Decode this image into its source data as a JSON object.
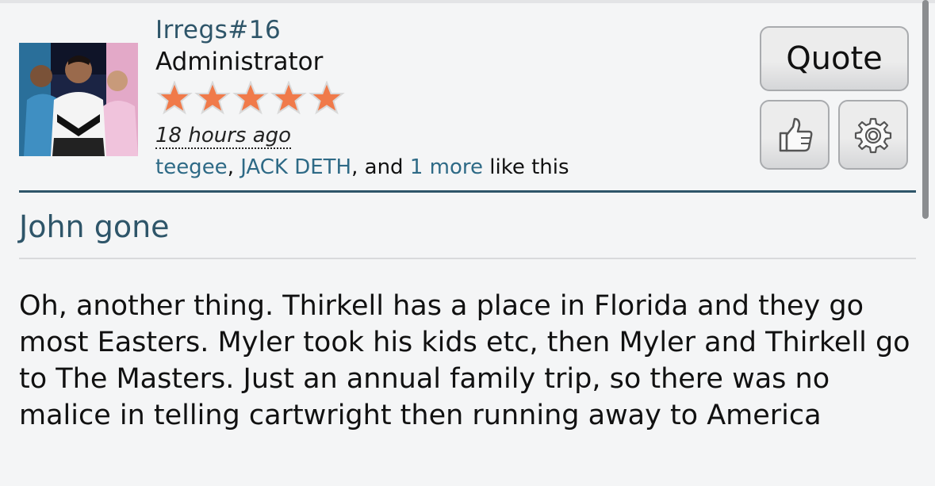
{
  "post": {
    "username": "Irregs#16",
    "role": "Administrator",
    "star_count": 5,
    "timestamp": "18 hours ago",
    "likes": {
      "user1": "teegee",
      "sep1": ", ",
      "user2": "JACK DETH",
      "sep2": ", and ",
      "more": "1 more",
      "suffix": " like this"
    },
    "title": "John gone",
    "body": "Oh, another thing. Thirkell has a place in Florida and they go most Easters. Myler took his kids etc, then Myler and Thirkell go to The Masters. Just an annual family trip, so there was no malice in telling cartwright then running away to America"
  },
  "buttons": {
    "quote_label": "Quote",
    "like_icon": "thumbs-up-icon",
    "settings_icon": "gear-icon"
  },
  "colors": {
    "link": "#2e6a86",
    "accent": "#2e5569",
    "star": "#f07a4a"
  }
}
